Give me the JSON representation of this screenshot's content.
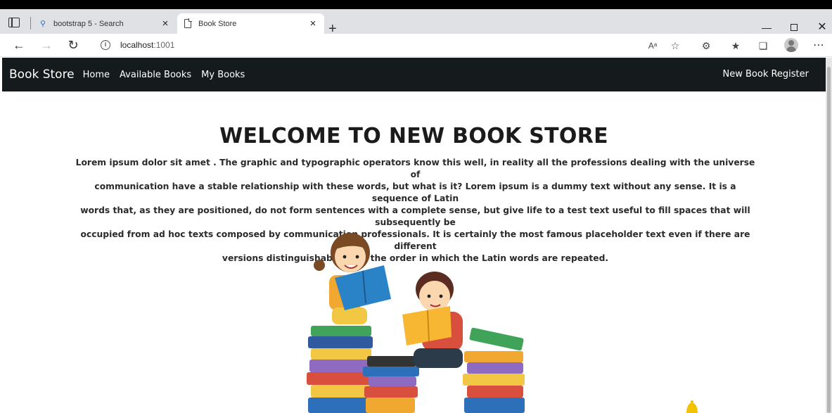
{
  "browser": {
    "tabs": [
      {
        "title": "bootstrap 5 - Search",
        "active": false,
        "icon": "search-icon"
      },
      {
        "title": "Book Store",
        "active": true,
        "icon": "document-icon"
      }
    ],
    "new_tab_symbol": "+",
    "close_symbol": "×",
    "url_host": "localhost",
    "url_port": ":1001",
    "window_controls": {
      "minimize": "—",
      "maximize": "☐",
      "close": "✕"
    },
    "toolbar_icons": [
      "read-aloud-icon",
      "add-favorite-icon",
      "extensions-icon",
      "favorites-icon",
      "collections-icon",
      "profile-icon",
      "more-icon"
    ]
  },
  "navbar": {
    "brand": "Book Store",
    "links": [
      "Home",
      "Available Books",
      "My Books"
    ],
    "right_link": "New Book Register",
    "bg_color": "#151a1c"
  },
  "hero": {
    "title": "WELCOME TO NEW BOOK STORE",
    "paragraph_lines": [
      "Lorem ipsum dolor sit amet . The graphic and typographic operators know this well, in reality all the professions dealing with the universe of",
      "communication have a stable relationship with these words, but what is it? Lorem ipsum is a dummy text without any sense. It is a sequence of Latin",
      "words that, as they are positioned, do not form sentences with a complete sense, but give life to a test text useful to fill spaces that will subsequently be",
      "occupied from ad hoc texts composed by communication professionals. It is certainly the most famous placeholder text even if there are different",
      "versions distinguishable from the order in which the Latin words are repeated."
    ]
  }
}
